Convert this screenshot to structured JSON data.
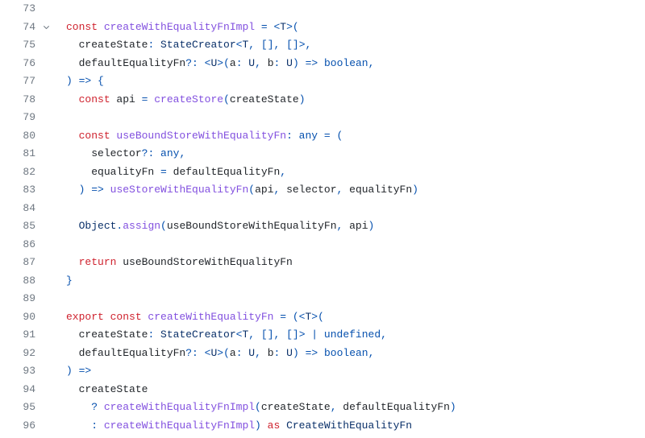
{
  "lines": [
    {
      "num": "73",
      "fold": false,
      "tokens": []
    },
    {
      "num": "74",
      "fold": true,
      "tokens": [
        {
          "t": "const ",
          "c": "kw"
        },
        {
          "t": "createWithEqualityFnImpl",
          "c": "fn"
        },
        {
          "t": " = <",
          "c": "op"
        },
        {
          "t": "T",
          "c": "type"
        },
        {
          "t": ">(",
          "c": "op"
        }
      ]
    },
    {
      "num": "75",
      "fold": false,
      "tokens": [
        {
          "t": "  ",
          "c": "id"
        },
        {
          "t": "createState",
          "c": "id"
        },
        {
          "t": ": ",
          "c": "op"
        },
        {
          "t": "StateCreator",
          "c": "type"
        },
        {
          "t": "<",
          "c": "op"
        },
        {
          "t": "T",
          "c": "type"
        },
        {
          "t": ", [], []>,",
          "c": "op"
        }
      ]
    },
    {
      "num": "76",
      "fold": false,
      "tokens": [
        {
          "t": "  ",
          "c": "id"
        },
        {
          "t": "defaultEqualityFn",
          "c": "id"
        },
        {
          "t": "?: <",
          "c": "op"
        },
        {
          "t": "U",
          "c": "type"
        },
        {
          "t": ">(",
          "c": "op"
        },
        {
          "t": "a",
          "c": "id"
        },
        {
          "t": ": ",
          "c": "op"
        },
        {
          "t": "U",
          "c": "type"
        },
        {
          "t": ", ",
          "c": "op"
        },
        {
          "t": "b",
          "c": "id"
        },
        {
          "t": ": ",
          "c": "op"
        },
        {
          "t": "U",
          "c": "type"
        },
        {
          "t": ") ",
          "c": "op"
        },
        {
          "t": "=>",
          "c": "op"
        },
        {
          "t": " ",
          "c": "id"
        },
        {
          "t": "boolean",
          "c": "str"
        },
        {
          "t": ",",
          "c": "op"
        }
      ]
    },
    {
      "num": "77",
      "fold": false,
      "tokens": [
        {
          "t": ") ",
          "c": "op"
        },
        {
          "t": "=>",
          "c": "op"
        },
        {
          "t": " {",
          "c": "op"
        }
      ]
    },
    {
      "num": "78",
      "fold": false,
      "tokens": [
        {
          "t": "  ",
          "c": "id"
        },
        {
          "t": "const ",
          "c": "kw"
        },
        {
          "t": "api",
          "c": "id"
        },
        {
          "t": " = ",
          "c": "op"
        },
        {
          "t": "createStore",
          "c": "fn"
        },
        {
          "t": "(",
          "c": "op"
        },
        {
          "t": "createState",
          "c": "id"
        },
        {
          "t": ")",
          "c": "op"
        }
      ]
    },
    {
      "num": "79",
      "fold": false,
      "tokens": []
    },
    {
      "num": "80",
      "fold": false,
      "tokens": [
        {
          "t": "  ",
          "c": "id"
        },
        {
          "t": "const ",
          "c": "kw"
        },
        {
          "t": "useBoundStoreWithEqualityFn",
          "c": "fn"
        },
        {
          "t": ": ",
          "c": "op"
        },
        {
          "t": "any",
          "c": "str"
        },
        {
          "t": " = (",
          "c": "op"
        }
      ]
    },
    {
      "num": "81",
      "fold": false,
      "tokens": [
        {
          "t": "    ",
          "c": "id"
        },
        {
          "t": "selector",
          "c": "id"
        },
        {
          "t": "?: ",
          "c": "op"
        },
        {
          "t": "any",
          "c": "str"
        },
        {
          "t": ",",
          "c": "op"
        }
      ]
    },
    {
      "num": "82",
      "fold": false,
      "tokens": [
        {
          "t": "    ",
          "c": "id"
        },
        {
          "t": "equalityFn",
          "c": "id"
        },
        {
          "t": " = ",
          "c": "op"
        },
        {
          "t": "defaultEqualityFn",
          "c": "id"
        },
        {
          "t": ",",
          "c": "op"
        }
      ]
    },
    {
      "num": "83",
      "fold": false,
      "tokens": [
        {
          "t": "  ) ",
          "c": "op"
        },
        {
          "t": "=>",
          "c": "op"
        },
        {
          "t": " ",
          "c": "id"
        },
        {
          "t": "useStoreWithEqualityFn",
          "c": "fn"
        },
        {
          "t": "(",
          "c": "op"
        },
        {
          "t": "api",
          "c": "id"
        },
        {
          "t": ", ",
          "c": "op"
        },
        {
          "t": "selector",
          "c": "id"
        },
        {
          "t": ", ",
          "c": "op"
        },
        {
          "t": "equalityFn",
          "c": "id"
        },
        {
          "t": ")",
          "c": "op"
        }
      ]
    },
    {
      "num": "84",
      "fold": false,
      "tokens": []
    },
    {
      "num": "85",
      "fold": false,
      "tokens": [
        {
          "t": "  ",
          "c": "id"
        },
        {
          "t": "Object",
          "c": "type"
        },
        {
          "t": ".",
          "c": "op"
        },
        {
          "t": "assign",
          "c": "fn"
        },
        {
          "t": "(",
          "c": "op"
        },
        {
          "t": "useBoundStoreWithEqualityFn",
          "c": "id"
        },
        {
          "t": ", ",
          "c": "op"
        },
        {
          "t": "api",
          "c": "id"
        },
        {
          "t": ")",
          "c": "op"
        }
      ]
    },
    {
      "num": "86",
      "fold": false,
      "tokens": []
    },
    {
      "num": "87",
      "fold": false,
      "tokens": [
        {
          "t": "  ",
          "c": "id"
        },
        {
          "t": "return ",
          "c": "kw"
        },
        {
          "t": "useBoundStoreWithEqualityFn",
          "c": "id"
        }
      ]
    },
    {
      "num": "88",
      "fold": false,
      "tokens": [
        {
          "t": "}",
          "c": "op"
        }
      ]
    },
    {
      "num": "89",
      "fold": false,
      "tokens": []
    },
    {
      "num": "90",
      "fold": false,
      "tokens": [
        {
          "t": "export ",
          "c": "kw"
        },
        {
          "t": "const ",
          "c": "kw"
        },
        {
          "t": "createWithEqualityFn",
          "c": "fn"
        },
        {
          "t": " = (<",
          "c": "op"
        },
        {
          "t": "T",
          "c": "type"
        },
        {
          "t": ">(",
          "c": "op"
        }
      ]
    },
    {
      "num": "91",
      "fold": false,
      "tokens": [
        {
          "t": "  ",
          "c": "id"
        },
        {
          "t": "createState",
          "c": "id"
        },
        {
          "t": ": ",
          "c": "op"
        },
        {
          "t": "StateCreator",
          "c": "type"
        },
        {
          "t": "<",
          "c": "op"
        },
        {
          "t": "T",
          "c": "type"
        },
        {
          "t": ", [], []> | ",
          "c": "op"
        },
        {
          "t": "undefined",
          "c": "str"
        },
        {
          "t": ",",
          "c": "op"
        }
      ]
    },
    {
      "num": "92",
      "fold": false,
      "tokens": [
        {
          "t": "  ",
          "c": "id"
        },
        {
          "t": "defaultEqualityFn",
          "c": "id"
        },
        {
          "t": "?: <",
          "c": "op"
        },
        {
          "t": "U",
          "c": "type"
        },
        {
          "t": ">(",
          "c": "op"
        },
        {
          "t": "a",
          "c": "id"
        },
        {
          "t": ": ",
          "c": "op"
        },
        {
          "t": "U",
          "c": "type"
        },
        {
          "t": ", ",
          "c": "op"
        },
        {
          "t": "b",
          "c": "id"
        },
        {
          "t": ": ",
          "c": "op"
        },
        {
          "t": "U",
          "c": "type"
        },
        {
          "t": ") ",
          "c": "op"
        },
        {
          "t": "=>",
          "c": "op"
        },
        {
          "t": " ",
          "c": "id"
        },
        {
          "t": "boolean",
          "c": "str"
        },
        {
          "t": ",",
          "c": "op"
        }
      ]
    },
    {
      "num": "93",
      "fold": false,
      "tokens": [
        {
          "t": ") ",
          "c": "op"
        },
        {
          "t": "=>",
          "c": "op"
        }
      ]
    },
    {
      "num": "94",
      "fold": false,
      "tokens": [
        {
          "t": "  ",
          "c": "id"
        },
        {
          "t": "createState",
          "c": "id"
        }
      ]
    },
    {
      "num": "95",
      "fold": false,
      "tokens": [
        {
          "t": "    ? ",
          "c": "op"
        },
        {
          "t": "createWithEqualityFnImpl",
          "c": "fn"
        },
        {
          "t": "(",
          "c": "op"
        },
        {
          "t": "createState",
          "c": "id"
        },
        {
          "t": ", ",
          "c": "op"
        },
        {
          "t": "defaultEqualityFn",
          "c": "id"
        },
        {
          "t": ")",
          "c": "op"
        }
      ]
    },
    {
      "num": "96",
      "fold": false,
      "tokens": [
        {
          "t": "    : ",
          "c": "op"
        },
        {
          "t": "createWithEqualityFnImpl",
          "c": "fn"
        },
        {
          "t": ") ",
          "c": "op"
        },
        {
          "t": "as ",
          "c": "kw"
        },
        {
          "t": "CreateWithEqualityFn",
          "c": "type"
        }
      ]
    }
  ]
}
